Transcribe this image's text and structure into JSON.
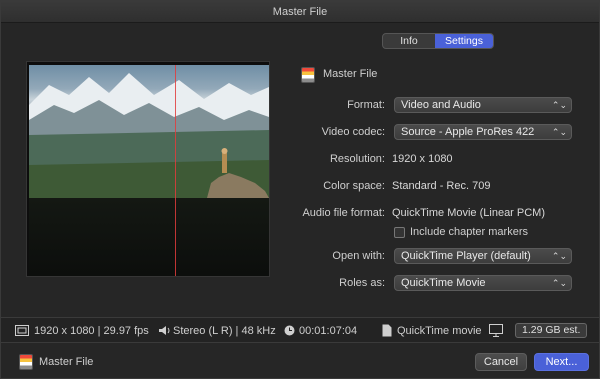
{
  "window": {
    "title": "Master File"
  },
  "tabs": [
    {
      "label": "Info",
      "selected": false
    },
    {
      "label": "Settings",
      "selected": true
    }
  ],
  "settings": {
    "title": "Master File",
    "format": {
      "label": "Format:",
      "value": "Video and Audio"
    },
    "video_codec": {
      "label": "Video codec:",
      "value": "Source - Apple ProRes 422"
    },
    "resolution": {
      "label": "Resolution:",
      "value": "1920 x 1080"
    },
    "color_space": {
      "label": "Color space:",
      "value": "Standard - Rec. 709"
    },
    "audio_file_format": {
      "label": "Audio file format:",
      "value": "QuickTime Movie (Linear PCM)"
    },
    "chapter_markers": {
      "label": "Include chapter markers",
      "checked": false
    },
    "open_with": {
      "label": "Open with:",
      "value": "QuickTime Player (default)"
    },
    "roles_as": {
      "label": "Roles as:",
      "value": "QuickTime Movie"
    }
  },
  "info_bar": {
    "video": "1920 x 1080 | 29.97 fps",
    "audio": "Stereo (L R) | 48 kHz",
    "duration": "00:01:07:04",
    "file_type": "QuickTime movie",
    "size": "1.29 GB est."
  },
  "footer": {
    "title": "Master File",
    "cancel_label": "Cancel",
    "next_label": "Next..."
  },
  "icons": {
    "app": "compressor-filmstrip-icon",
    "film": "film-icon",
    "speaker": "speaker-icon",
    "clock": "clock-icon",
    "document": "document-icon",
    "display": "display-icon",
    "chevron": "popup-chevron-icon"
  },
  "colors": {
    "accent": "#4a61d8",
    "background": "#262626",
    "playhead": "#e03c3c"
  }
}
